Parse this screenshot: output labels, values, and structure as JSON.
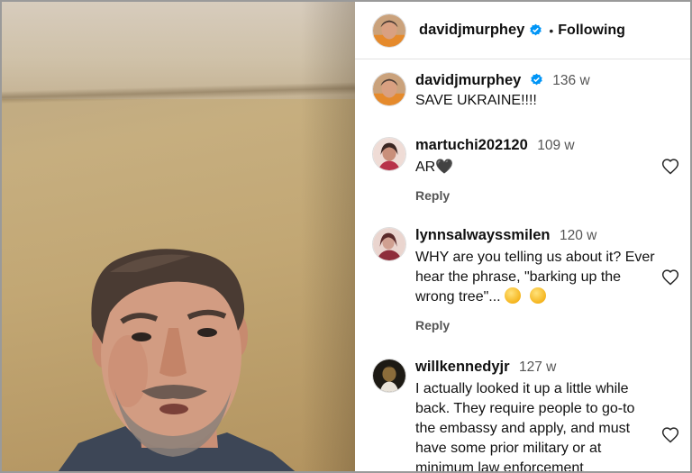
{
  "post": {
    "username": "davidjmurphey",
    "follow_status": "Following",
    "separator": "•"
  },
  "caption": {
    "username": "davidjmurphey",
    "time": "136 w",
    "text": "SAVE UKRAINE!!!!"
  },
  "comments": [
    {
      "username": "martuchi202120",
      "time": "109 w",
      "text": "AR🖤",
      "reply_label": "Reply",
      "avatar_colors": [
        "#e8c9c2",
        "#b8324a"
      ]
    },
    {
      "username": "lynnsalwayssmilen",
      "time": "120 w",
      "text": "WHY are you telling us about it? Ever hear the phrase, \"barking up the wrong tree\"...",
      "emojis": [
        "rolling-eyes-emoji",
        "winking-tongue-emoji"
      ],
      "reply_label": "Reply",
      "avatar_colors": [
        "#d8a9a6",
        "#8e2d3b"
      ]
    },
    {
      "username": "willkennedyjr",
      "time": "127 w",
      "text": "I actually looked it up a little while back. They require people to go-to the embassy and apply, and must have some prior military or at minimum law enforcement",
      "avatar_colors": [
        "#1d1a14",
        "#8b6c3a"
      ]
    }
  ],
  "icons": {
    "verified": "verified-badge-icon",
    "like": "heart-icon"
  },
  "colors": {
    "verified_blue": "#0095f6",
    "text": "#111111",
    "muted": "#555555",
    "divider": "#e2e2e2"
  }
}
